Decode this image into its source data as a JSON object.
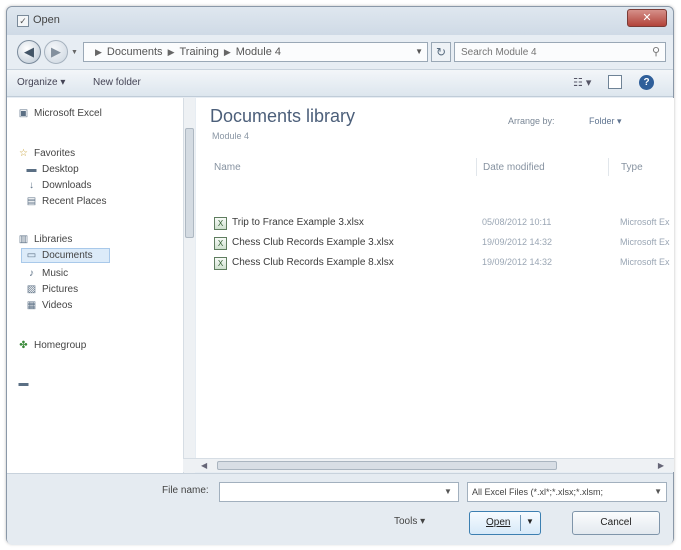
{
  "window": {
    "title": "Open"
  },
  "address": {
    "breadcrumbs": [
      "Documents",
      "Training",
      "Module 4"
    ],
    "search_placeholder": "Search Module 4"
  },
  "toolbar": {
    "organize": "Organize",
    "new_folder": "New folder"
  },
  "nav": {
    "items": [
      {
        "label": "Microsoft Excel",
        "icon": "excel-icon"
      },
      {
        "label": "Favorites",
        "icon": "star-icon"
      },
      {
        "label": "Desktop",
        "icon": "desktop-icon"
      },
      {
        "label": "Downloads",
        "icon": "downloads-icon"
      },
      {
        "label": "Recent Places",
        "icon": "recent-places-icon"
      },
      {
        "label": "Libraries",
        "icon": "libraries-icon"
      },
      {
        "label": "Documents",
        "icon": "documents-icon"
      },
      {
        "label": "Music",
        "icon": "music-icon"
      },
      {
        "label": "Pictures",
        "icon": "pictures-icon"
      },
      {
        "label": "Videos",
        "icon": "videos-icon"
      },
      {
        "label": "Homegroup",
        "icon": "homegroup-icon"
      }
    ]
  },
  "library": {
    "title": "Documents library",
    "subtitle": "Module 4",
    "arrange_label": "Arrange by:",
    "arrange_value": "Folder"
  },
  "columns": {
    "name": "Name",
    "date": "Date modified",
    "type": "Type"
  },
  "files": [
    {
      "name": "Trip to France Example 3.xlsx",
      "date": "05/08/2012 10:11",
      "type": "Microsoft Ex"
    },
    {
      "name": "Chess Club Records Example 3.xlsx",
      "date": "19/09/2012 14:32",
      "type": "Microsoft Ex"
    },
    {
      "name": "Chess Club Records Example 8.xlsx",
      "date": "19/09/2012 14:32",
      "type": "Microsoft Ex"
    }
  ],
  "footer": {
    "filename_label": "File name:",
    "filename_value": "",
    "filter": "All Excel Files (*.xl*;*.xlsx;*.xlsm;",
    "tools": "Tools",
    "open": "Open",
    "cancel": "Cancel"
  }
}
